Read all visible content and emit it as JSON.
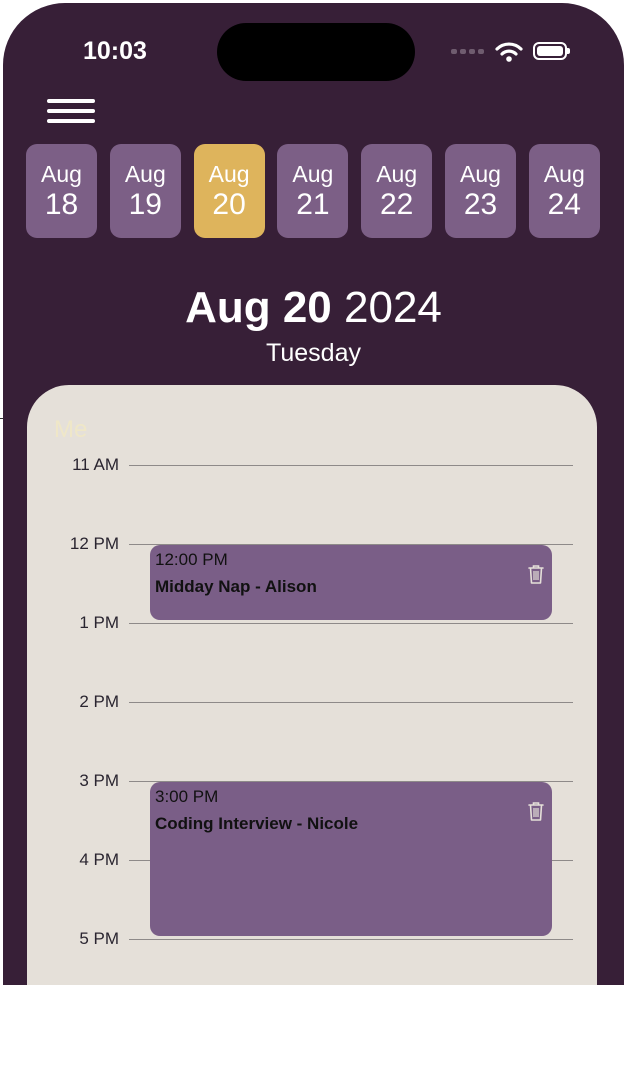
{
  "status_bar": {
    "time": "10:03"
  },
  "date_strip": [
    {
      "month": "Aug",
      "day": "18",
      "selected": false
    },
    {
      "month": "Aug",
      "day": "19",
      "selected": false
    },
    {
      "month": "Aug",
      "day": "20",
      "selected": true
    },
    {
      "month": "Aug",
      "day": "21",
      "selected": false
    },
    {
      "month": "Aug",
      "day": "22",
      "selected": false
    },
    {
      "month": "Aug",
      "day": "23",
      "selected": false
    },
    {
      "month": "Aug",
      "day": "24",
      "selected": false
    }
  ],
  "header": {
    "date": "Aug 20",
    "year": "2024",
    "weekday": "Tuesday"
  },
  "panel": {
    "owner_label": "Me",
    "hours": [
      "11 AM",
      "12 PM",
      "1 PM",
      "2 PM",
      "3 PM",
      "4 PM",
      "5 PM"
    ]
  },
  "events": [
    {
      "time": "12:00 PM",
      "title": "Midday Nap - Alison"
    },
    {
      "time": "3:00 PM",
      "title": "Coding Interview - Nicole"
    }
  ],
  "colors": {
    "background": "#371f37",
    "chip": "#7c5f86",
    "chip_selected": "#deb45c",
    "panel": "#e5e0d9",
    "event": "#7a5e87"
  }
}
